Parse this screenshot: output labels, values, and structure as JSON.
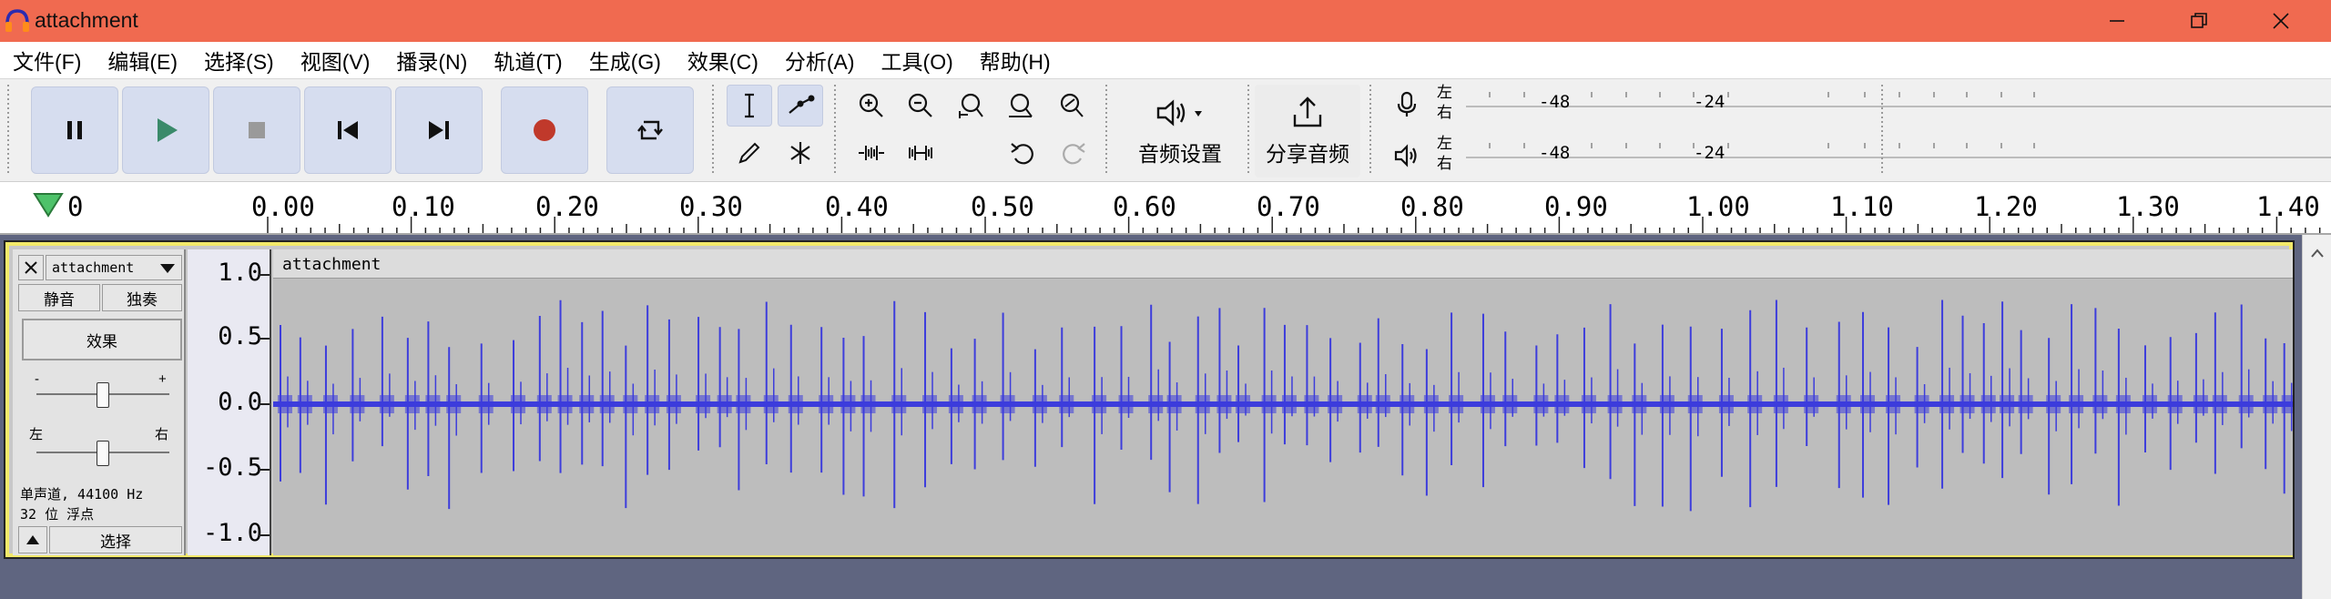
{
  "window": {
    "title": "attachment",
    "minimize_icon": "minimize-icon",
    "restore_icon": "restore-icon",
    "close_icon": "close-icon"
  },
  "menu": [
    "文件(F)",
    "编辑(E)",
    "选择(S)",
    "视图(V)",
    "播录(N)",
    "轨道(T)",
    "生成(G)",
    "效果(C)",
    "分析(A)",
    "工具(O)",
    "帮助(H)"
  ],
  "transport": {
    "buttons": [
      "pause-icon",
      "play-icon",
      "stop-icon",
      "skip-start-icon",
      "skip-end-icon",
      "record-icon",
      "loop-icon"
    ],
    "play_color": "#3a8a6a",
    "record_color": "#c0392b"
  },
  "tools": {
    "icons": [
      "selection-tool-icon",
      "envelope-tool-icon",
      "draw-tool-icon",
      "multi-tool-icon"
    ]
  },
  "edit": {
    "icons": [
      "zoom-in-icon",
      "zoom-out-icon",
      "fit-selection-icon",
      "fit-project-icon",
      "zoom-toggle-icon",
      "trim-icon",
      "silence-icon",
      "undo-icon",
      "redo-icon"
    ]
  },
  "audio_setup": {
    "label": "音频设置"
  },
  "share_audio": {
    "label": "分享音频"
  },
  "meters": {
    "record": {
      "left": "左",
      "right": "右",
      "ticks": [
        "-48",
        "-24"
      ]
    },
    "playback": {
      "left": "左",
      "right": "右",
      "ticks": [
        "-48",
        "-24"
      ]
    }
  },
  "ruler": {
    "labels": [
      "0",
      "0.00",
      "0.10",
      "0.20",
      "0.30",
      "0.40",
      "0.50",
      "0.60",
      "0.70",
      "0.80",
      "0.90",
      "1.00",
      "1.10",
      "1.20",
      "1.30",
      "1.40"
    ]
  },
  "track": {
    "name": "attachment",
    "mute": "静音",
    "solo": "独奏",
    "effects": "效果",
    "gain_minus": "-",
    "gain_plus": "+",
    "pan_left": "左",
    "pan_right": "右",
    "info_line1": "单声道, 44100 Hz",
    "info_line2": "32 位 浮点",
    "select": "选择",
    "clip_name": "attachment",
    "scale": [
      "1.0",
      "0.5",
      "0.0",
      "-0.5",
      "-1.0"
    ],
    "wave_color": "#3d3ddc"
  }
}
